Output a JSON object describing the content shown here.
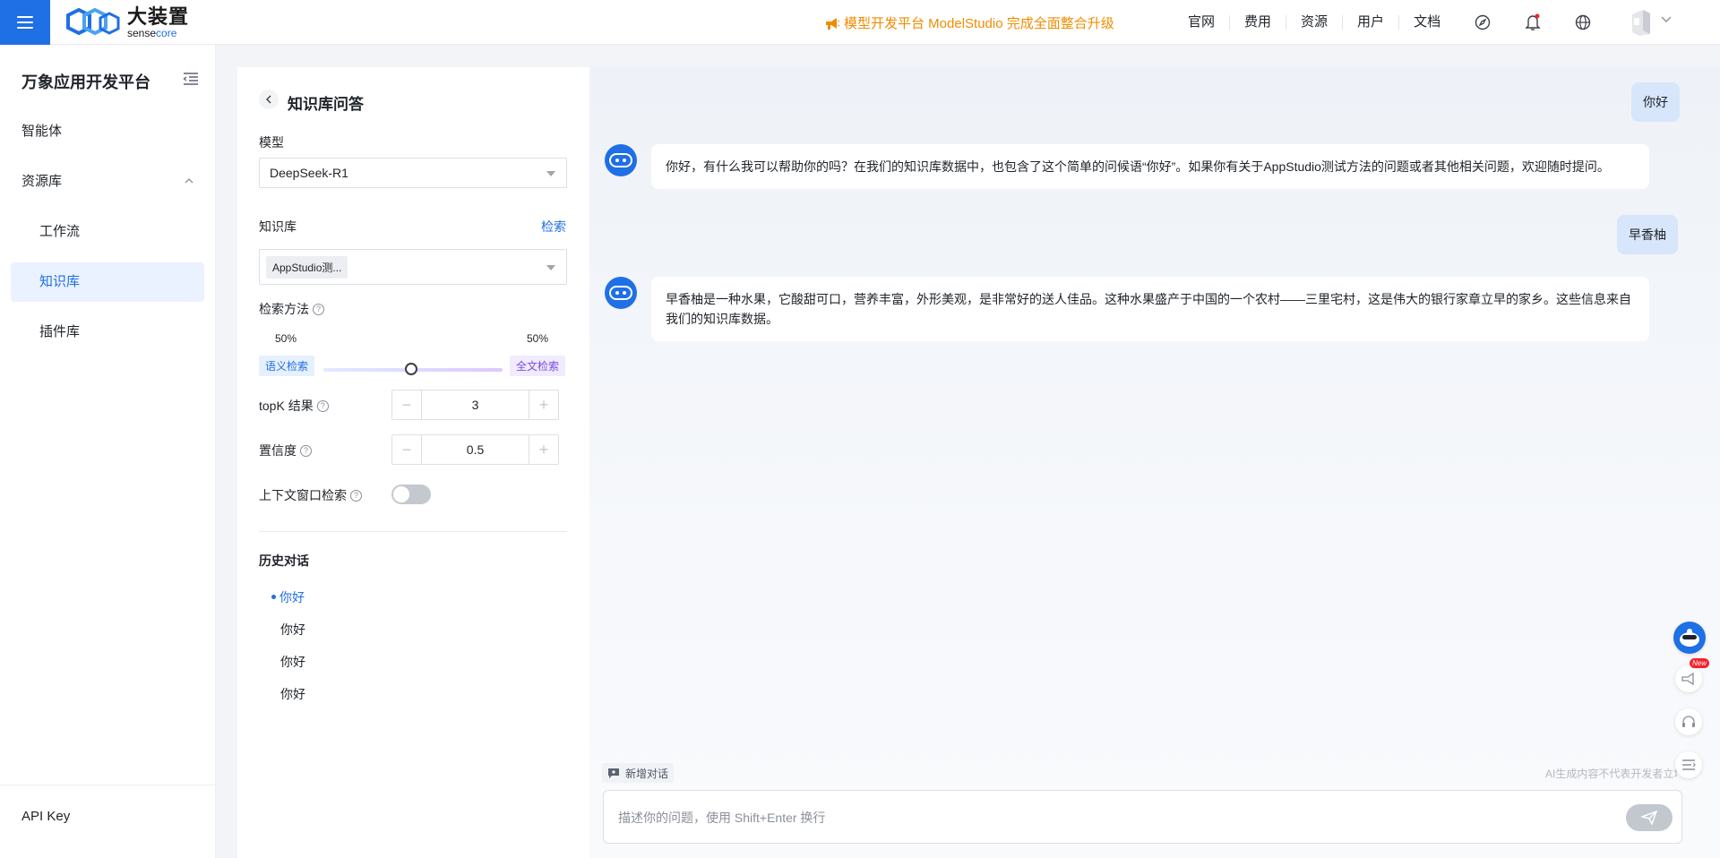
{
  "topbar": {
    "logo_cn": "大装置",
    "logo_en_a": "sense",
    "logo_en_b": "core",
    "announcement": "模型开发平台 ModelStudio 完成全面整合升级",
    "nav": [
      "官网",
      "费用",
      "资源",
      "用户",
      "文档"
    ],
    "icons": [
      "compass-icon",
      "bell-icon",
      "globe-icon"
    ],
    "accent": "#1f6fe5",
    "announce_color": "#f08c00"
  },
  "sidebar": {
    "title": "万象应用开发平台",
    "items": [
      {
        "label": "智能体"
      },
      {
        "label": "资源库"
      },
      {
        "label": "工作流"
      },
      {
        "label": "知识库"
      },
      {
        "label": "插件库"
      }
    ],
    "footer": "API Key"
  },
  "panel": {
    "title": "知识库问答",
    "model_label": "模型",
    "model_value": "DeepSeek-R1",
    "kb_label": "知识库",
    "kb_link": "检索",
    "kb_tag": "AppStudio测...",
    "method_label": "检索方法",
    "semantic_pct": "50%",
    "fulltext_pct": "50%",
    "semantic_label": "语义检索",
    "fulltext_label": "全文检索",
    "slider_value": 0.5,
    "topk_label": "topK 结果",
    "topk_value": "3",
    "conf_label": "置信度",
    "conf_value": "0.5",
    "context_label": "上下文窗口检索",
    "context_enabled": false,
    "history_title": "历史对话",
    "history": [
      "你好",
      "你好",
      "你好",
      "你好"
    ]
  },
  "chat": {
    "messages": [
      {
        "role": "user",
        "text": "你好"
      },
      {
        "role": "bot",
        "text": "你好，有什么我可以帮助你的吗？在我们的知识库数据中，也包含了这个简单的问候语“你好”。如果你有关于AppStudio测试方法的问题或者其他相关问题，欢迎随时提问。"
      },
      {
        "role": "user",
        "text": "早香柚"
      },
      {
        "role": "bot",
        "text": "早香柚是一种水果，它酸甜可口，营养丰富，外形美观，是非常好的送人佳品。这种水果盛产于中国的一个农村——三里宅村，这是伟大的银行家章立早的家乡。这些信息来自我们的知识库数据。"
      }
    ],
    "new_chat": "新增对话",
    "disclaimer": "AI生成内容不代表开发者立场",
    "input_placeholder": "描述你的问题，使用 Shift+Enter 换行"
  },
  "float_tools": {
    "badge": "New"
  }
}
